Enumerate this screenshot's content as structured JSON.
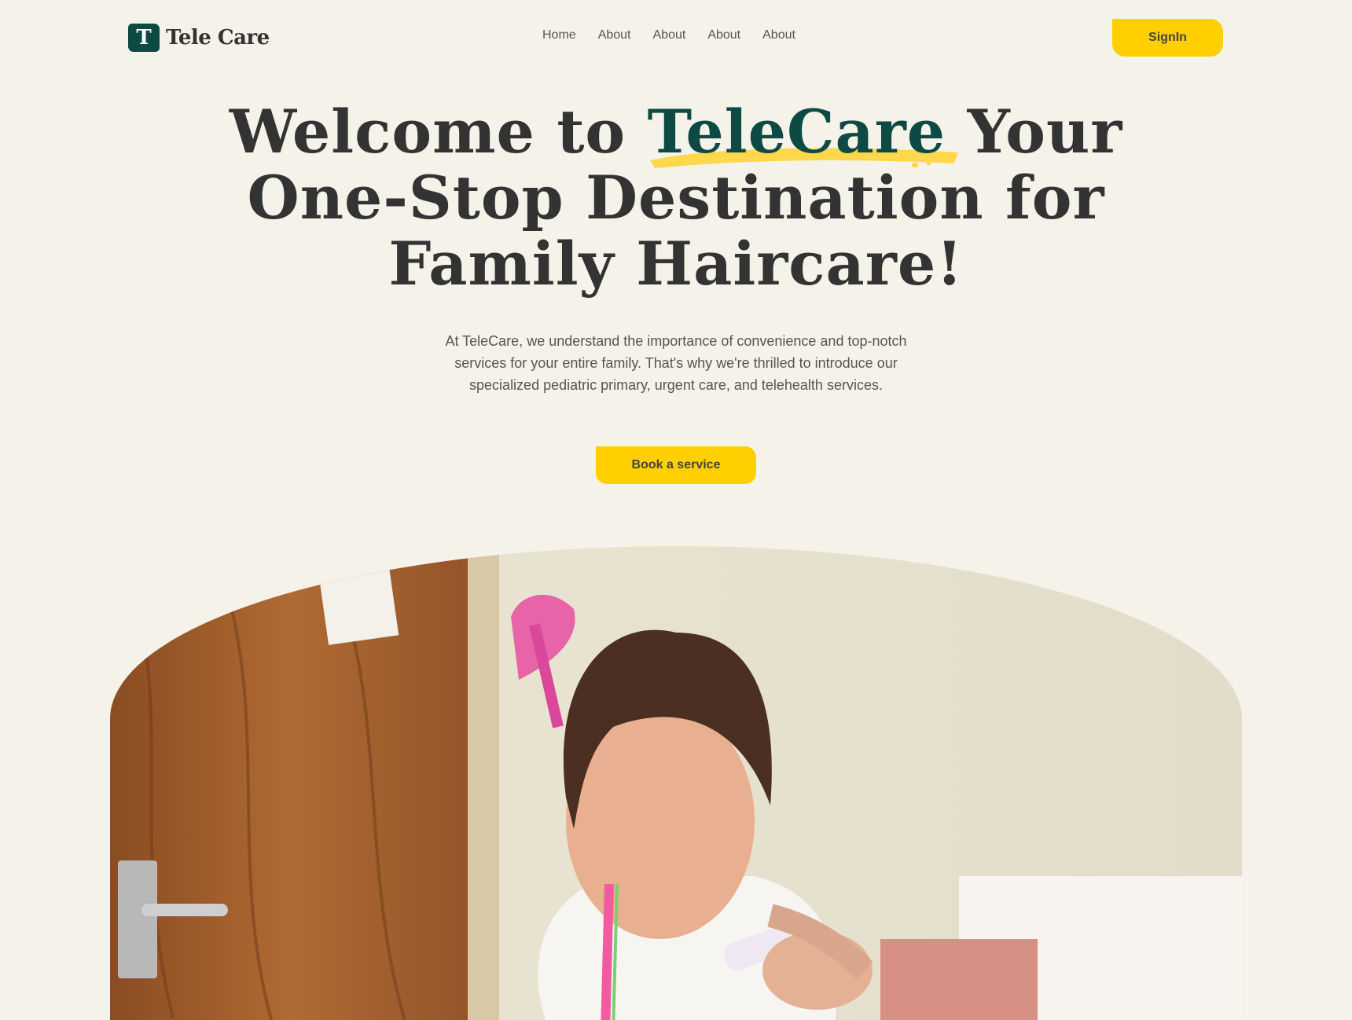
{
  "brand": {
    "logo_letter": "T",
    "name": "Tele Care"
  },
  "nav": {
    "links": [
      "Home",
      "About",
      "About",
      "About",
      "About"
    ],
    "signin_label": "SignIn"
  },
  "hero": {
    "title_before": "Welcome to",
    "title_brand": "TeleCare",
    "title_after": "Your One-Stop Destination for Family Haircare!",
    "subtitle": "At TeleCare, we understand the importance of convenience and top-notch services for your entire family. That's why we're thrilled to introduce our specialized pediatric primary, urgent care, and telehealth services.",
    "cta_label": "Book a service"
  },
  "colors": {
    "background": "#f5f2e9",
    "brand_green": "#0d4a44",
    "accent_yellow": "#ffcf00",
    "text_dark": "#333333"
  }
}
